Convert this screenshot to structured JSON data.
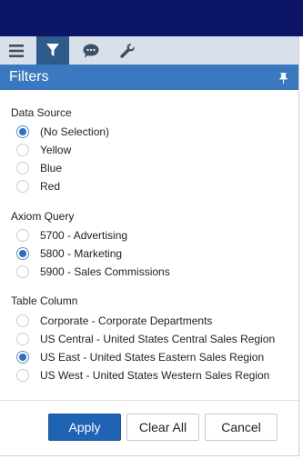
{
  "tabs": [
    {
      "icon": "menu-icon"
    },
    {
      "icon": "filter-icon"
    },
    {
      "icon": "comment-icon"
    },
    {
      "icon": "wrench-icon"
    }
  ],
  "panel": {
    "title": "Filters"
  },
  "sections": {
    "data_source": {
      "label": "Data Source",
      "options": [
        "(No Selection)",
        "Yellow",
        "Blue",
        "Red"
      ],
      "selected": "(No Selection)"
    },
    "axiom_query": {
      "label": "Axiom Query",
      "options": [
        "5700 - Advertising",
        "5800 - Marketing",
        "5900 - Sales Commissions"
      ],
      "selected": "5800 - Marketing"
    },
    "table_column": {
      "label": "Table Column",
      "options": [
        "Corporate - Corporate Departments",
        "US Central - United States Central Sales Region",
        "US East - United States Eastern Sales Region",
        "US West - United States Western Sales Region"
      ],
      "selected": "US East - United States Eastern Sales Region"
    }
  },
  "buttons": {
    "apply": "Apply",
    "clear_all": "Clear All",
    "cancel": "Cancel"
  },
  "colors": {
    "topbar": "#0c1566",
    "tabbar": "#d8e0ea",
    "active_tab": "#2f5a8c",
    "header": "#3a79c0",
    "primary_button": "#1f63b3"
  }
}
